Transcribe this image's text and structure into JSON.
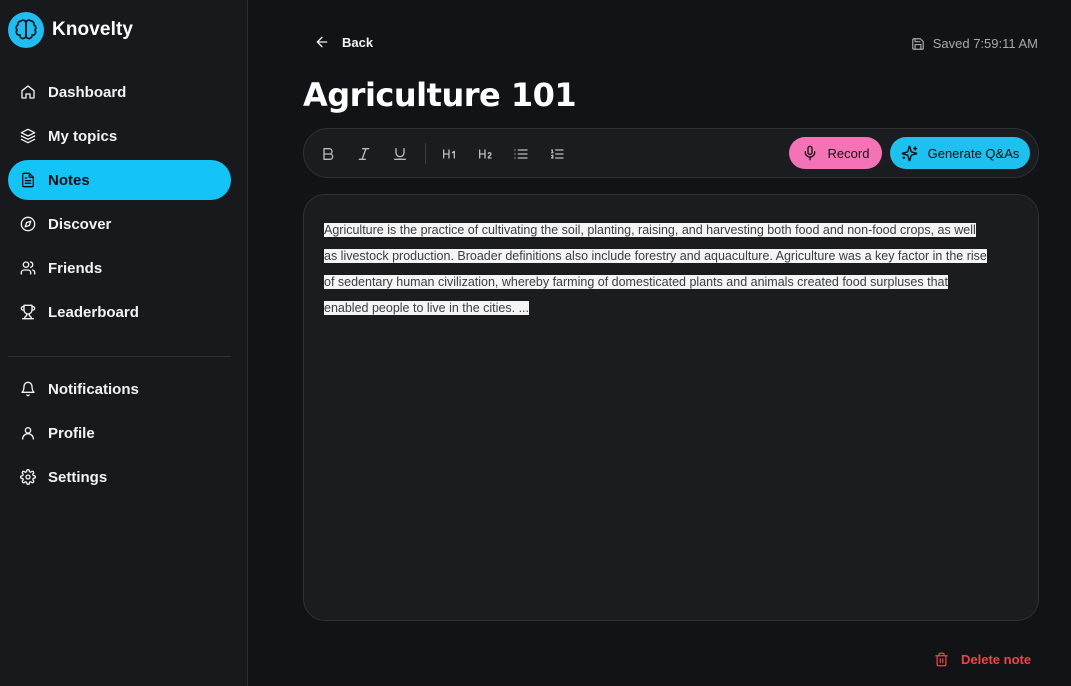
{
  "brand": {
    "name": "Knovelty",
    "logo_icon": "brain-icon",
    "accent": "#22bdf0"
  },
  "sidebar": {
    "items": [
      {
        "label": "Dashboard",
        "icon": "home-icon",
        "active": false
      },
      {
        "label": "My topics",
        "icon": "layers-icon",
        "active": false
      },
      {
        "label": "Notes",
        "icon": "document-icon",
        "active": true
      },
      {
        "label": "Discover",
        "icon": "compass-icon",
        "active": false
      },
      {
        "label": "Friends",
        "icon": "users-icon",
        "active": false
      },
      {
        "label": "Leaderboard",
        "icon": "trophy-icon",
        "active": false
      }
    ],
    "secondary": [
      {
        "label": "Notifications",
        "icon": "bell-icon"
      },
      {
        "label": "Profile",
        "icon": "user-icon"
      },
      {
        "label": "Settings",
        "icon": "gear-icon"
      }
    ]
  },
  "header": {
    "back_label": "Back",
    "saved_status": "Saved 7:59:11 AM"
  },
  "note": {
    "title": "Agriculture 101",
    "lines": [
      "Agriculture is the practice of cultivating the soil, planting, raising, and harvesting both food and non-food crops, as well",
      "as livestock production. Broader definitions also include forestry and aquaculture. Agriculture was a key factor in the rise",
      "of sedentary human civilization, whereby farming of domesticated plants and animals created food surpluses that",
      "enabled people to live in the cities. ..."
    ]
  },
  "toolbar": {
    "bold": "B",
    "italic": "I",
    "underline": "U",
    "h1": "H1",
    "h2": "H2",
    "record_label": "Record",
    "generate_label": "Generate Q&As",
    "record_color": "#f472b6",
    "generate_color": "#1ec0ef"
  },
  "footer": {
    "delete_label": "Delete note",
    "delete_color": "#ef4444"
  }
}
